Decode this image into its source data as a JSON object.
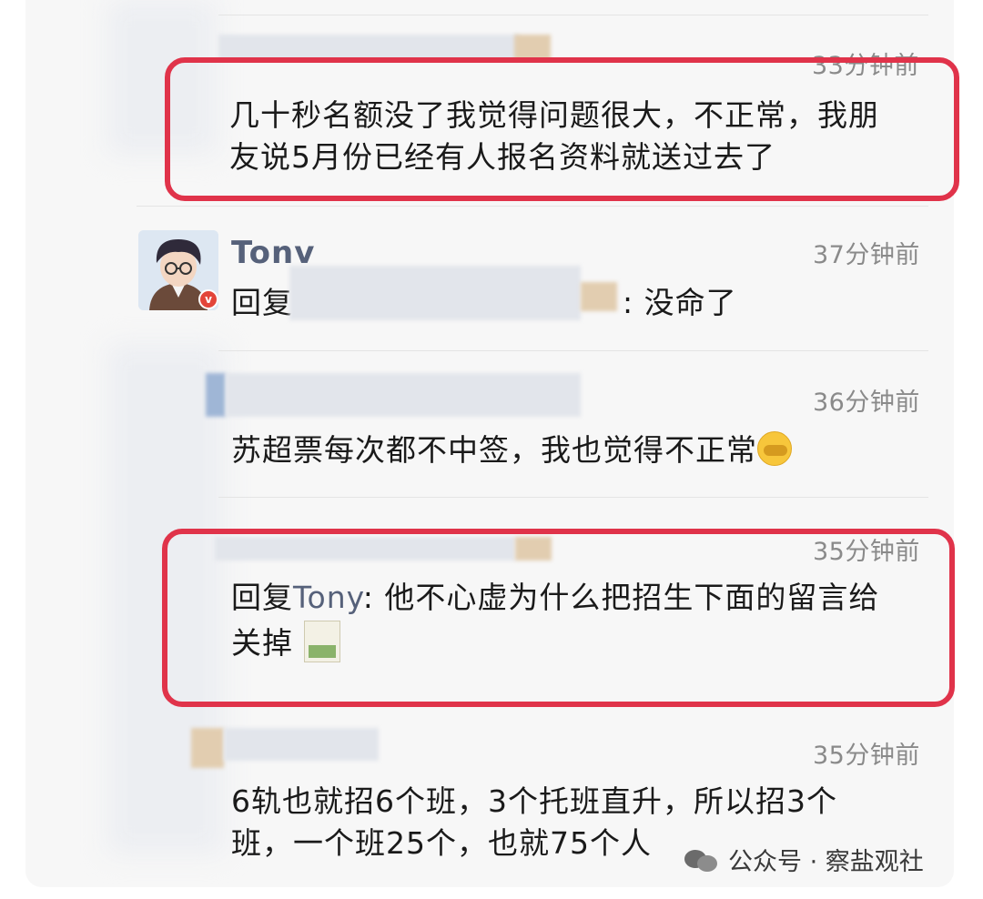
{
  "comments": [
    {
      "time": "33分钟前",
      "text_lines": [
        "几十秒名额没了我觉得问题很大，不正常，我朋",
        "友说5月份已经有人报名资料就送过去了"
      ]
    },
    {
      "author": "Tonv",
      "time": "37分钟前",
      "reply_prefix": "回复",
      "reply_suffix": ": 没命了"
    },
    {
      "time": "36分钟前",
      "text": "苏超票每次都不中签，我也觉得不正常"
    },
    {
      "time": "35分钟前",
      "reply_prefix": "回复",
      "reply_target": "Tony",
      "reply_line1": ": 他不心虚为什么把招生下面的留言给",
      "reply_line2": "关掉"
    },
    {
      "time": "35分钟前",
      "text_lines": [
        "6轨也就招6个班，3个托班直升，所以招3个",
        "班，一个班25个，也就75个人"
      ]
    }
  ],
  "avatar": {
    "badge": "v"
  },
  "watermark": "公众号 · 察盐观社",
  "colors": {
    "highlight": "#e0334a",
    "name": "#56617a",
    "time": "#8a8a8a"
  }
}
